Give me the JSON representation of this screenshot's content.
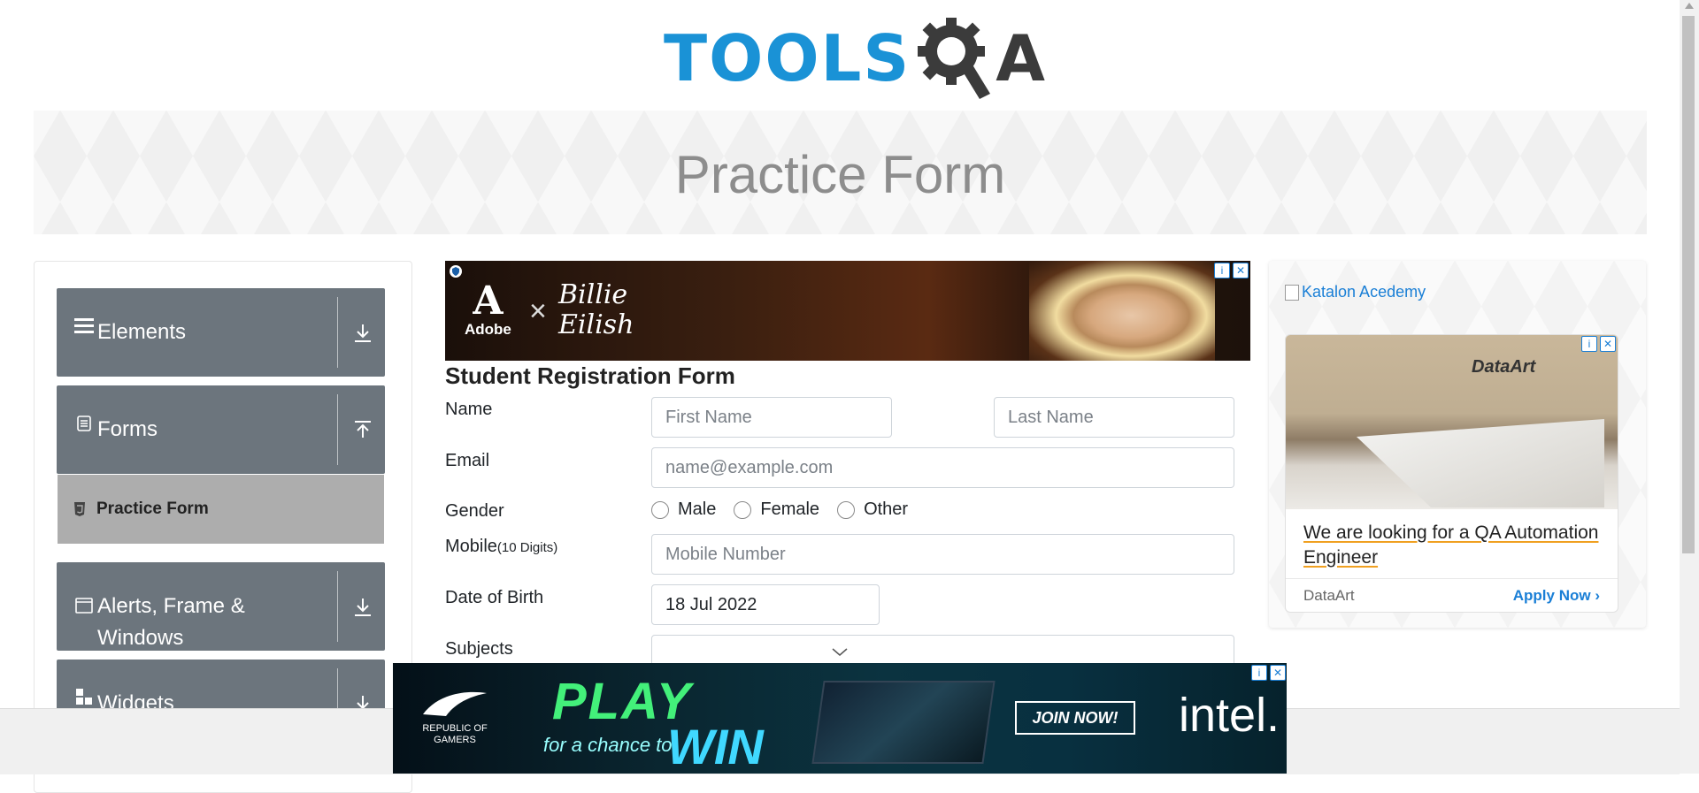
{
  "header": {
    "logo_left": "TOOLS",
    "logo_right": "A"
  },
  "banner": {
    "title": "Practice Form"
  },
  "sidebar": {
    "groups": [
      {
        "label": "Elements",
        "icon": "hamburger-icon",
        "arrow": "download-icon"
      },
      {
        "label": "Forms",
        "icon": "document-icon",
        "arrow": "upload-icon"
      },
      {
        "label": "Alerts, Frame & Windows",
        "icon": "window-icon",
        "arrow": "download-icon"
      },
      {
        "label": "Widgets",
        "icon": "widgets-icon",
        "arrow": "download-icon"
      }
    ],
    "active_item": {
      "label": "Practice Form",
      "icon": "html5-icon"
    }
  },
  "top_ad": {
    "brand": "Adobe",
    "collab": "Billie Eilish"
  },
  "form": {
    "title": "Student Registration Form",
    "name_label": "Name",
    "first_name_placeholder": "First Name",
    "last_name_placeholder": "Last Name",
    "email_label": "Email",
    "email_placeholder": "name@example.com",
    "gender_label": "Gender",
    "gender_options": [
      "Male",
      "Female",
      "Other"
    ],
    "mobile_label": "Mobile",
    "mobile_hint": "(10 Digits)",
    "mobile_placeholder": "Mobile Number",
    "dob_label": "Date of Birth",
    "dob_value": "18 Jul 2022",
    "subjects_label": "Subjects"
  },
  "right_ads": {
    "katalon_alt": "Katalon Acedemy",
    "dataart": {
      "brand": "DataArt",
      "headline": "We are looking for a QA Automation Engineer",
      "advertiser": "DataArt",
      "cta": "Apply Now"
    }
  },
  "bottom_ad": {
    "rog": "REPUBLIC OF GAMERS",
    "play": "PLAY",
    "chance": "for a chance to",
    "win": "WIN",
    "join": "JOIN NOW!",
    "intel": "intel."
  },
  "colors": {
    "accent": "#1a92d6",
    "sidebar_bg": "#6c757d",
    "active_bg": "#adadad",
    "link": "#1a7fd6"
  }
}
